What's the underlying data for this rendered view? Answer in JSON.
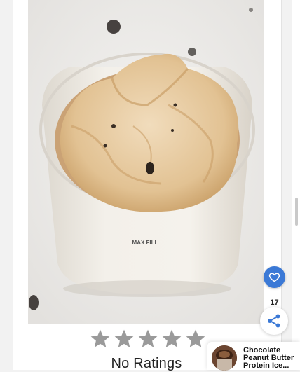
{
  "recipe_card": {
    "photo": {
      "icon": "recipe-photo",
      "jar_label": "MAX FILL"
    },
    "rating": {
      "stars_total": 5,
      "stars_filled": 0,
      "label": "No Ratings"
    }
  },
  "floating_actions": {
    "favorite_icon": "heart-icon",
    "favorite_count": "17",
    "share_icon": "share-icon",
    "accent_color": "#3b79d6"
  },
  "next_recipe": {
    "title": "Chocolate Peanut Butter Protein Ice..."
  }
}
